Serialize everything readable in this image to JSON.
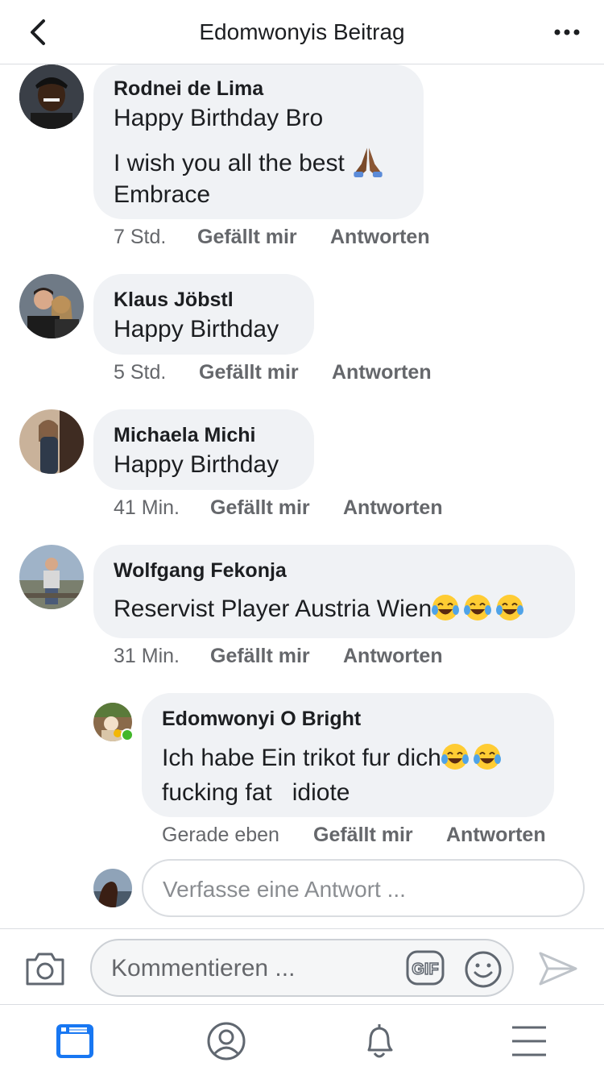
{
  "header": {
    "title": "Edomwonyis Beitrag"
  },
  "comments": [
    {
      "name": "Rodnei de Lima",
      "lines": [
        "Happy Birthday Bro",
        "I wish you all the best",
        "Embrace"
      ],
      "time": "7 Std.",
      "like": "Gefällt mir",
      "reply": "Antworten"
    },
    {
      "name": "Klaus Jöbstl",
      "lines": [
        "Happy Birthday"
      ],
      "time": "5 Std.",
      "like": "Gefällt mir",
      "reply": "Antworten"
    },
    {
      "name": "Michaela Michi",
      "lines": [
        "Happy Birthday"
      ],
      "time": "41 Min.",
      "like": "Gefällt mir",
      "reply": "Antworten"
    },
    {
      "name": "Wolfgang Fekonja",
      "lines": [
        "Reservist Player Austria Wien"
      ],
      "time": "31 Min.",
      "like": "Gefällt mir",
      "reply": "Antworten"
    }
  ],
  "reply_comment": {
    "name": "Edomwonyi O Bright",
    "lines": [
      "Ich habe Ein trikot fur dich",
      "fucking fat   idiote"
    ],
    "time": "Gerade eben",
    "like": "Gefällt mir",
    "reply": "Antworten"
  },
  "reply_input": {
    "placeholder": "Verfasse eine Antwort ..."
  },
  "composer": {
    "placeholder": "Kommentieren ...",
    "gif_label": "GIF"
  },
  "colors": {
    "accent": "#1877f2",
    "bubble": "#f0f2f5",
    "meta": "#65676b",
    "online": "#42b72a"
  },
  "icons": [
    "back-icon",
    "more-icon",
    "camera-icon",
    "gif-icon",
    "smiley-icon",
    "send-icon",
    "news-feed-icon",
    "profile-icon",
    "bell-icon",
    "menu-icon",
    "praying-hands-emoji",
    "laughing-tears-emoji"
  ]
}
